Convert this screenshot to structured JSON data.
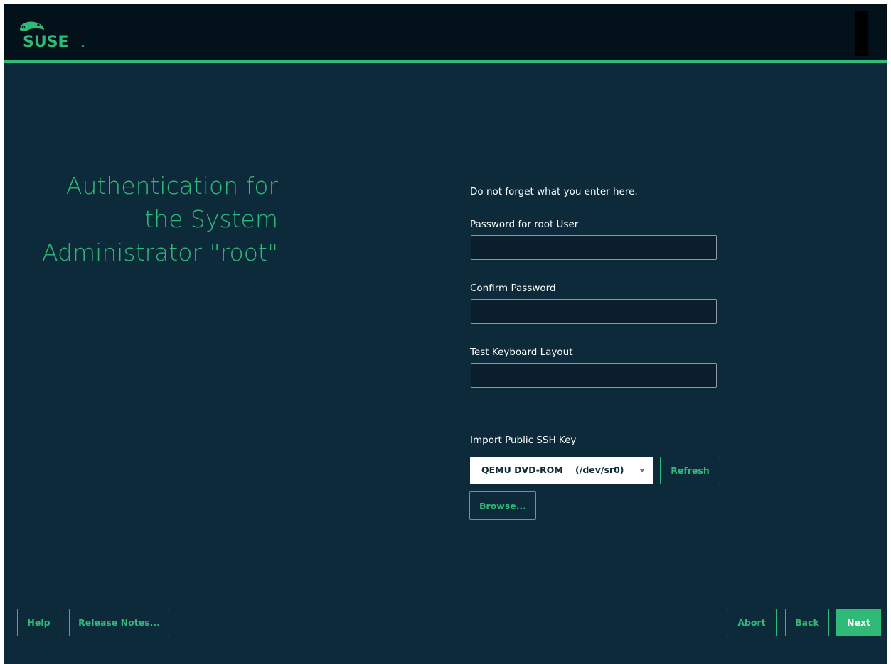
{
  "header": {
    "logo_text": "SUSE"
  },
  "colors": {
    "accent": "#30ba78",
    "background": "#0c2a3a",
    "topbar": "#02111a"
  },
  "title_lines": [
    "Authentication for",
    "the System",
    "Administrator \"root\""
  ],
  "notice": "Do not forget what you enter here.",
  "fields": {
    "password_label": "Password for root User",
    "password_value": "",
    "confirm_label": "Confirm Password",
    "confirm_value": "",
    "keyboard_label": "Test Keyboard Layout",
    "keyboard_value": ""
  },
  "ssh": {
    "label": "Import Public SSH Key",
    "device_selected": "QEMU DVD-ROM    (/dev/sr0)",
    "refresh_label": "Refresh",
    "browse_label": "Browse..."
  },
  "footer": {
    "help_label": "Help",
    "release_notes_label": "Release Notes...",
    "abort_label": "Abort",
    "back_label": "Back",
    "next_label": "Next"
  }
}
